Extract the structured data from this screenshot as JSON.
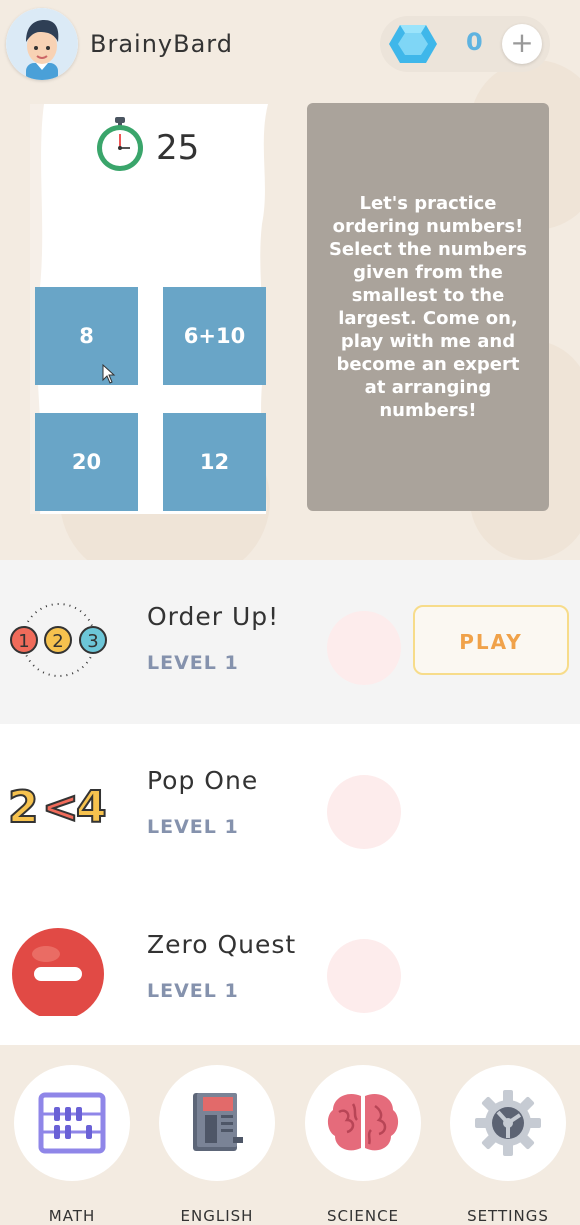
{
  "header": {
    "username": "BrainyBard",
    "gems": "0",
    "plus": "+"
  },
  "preview": {
    "timer": "25",
    "tiles": [
      "8",
      "6+10",
      "20",
      "12"
    ],
    "description": "Let's practice ordering numbers! Select the numbers given from the smallest to the largest. Come on, play with me and become an expert at arranging numbers!"
  },
  "games": [
    {
      "title": "Order Up!",
      "level": "LEVEL 1",
      "icon": "ordered-balls-icon",
      "selected": true
    },
    {
      "title": "Pop One",
      "level": "LEVEL 1",
      "icon": "two-less-than-four-icon",
      "selected": false
    },
    {
      "title": "Zero Quest",
      "level": "LEVEL 1",
      "icon": "red-minus-ball-icon",
      "selected": false
    }
  ],
  "play_label": "PLAY",
  "nav": [
    {
      "label": "MATH",
      "icon": "abacus-icon"
    },
    {
      "label": "ENGLISH",
      "icon": "book-icon"
    },
    {
      "label": "SCIENCE",
      "icon": "brain-icon"
    },
    {
      "label": "SETTINGS",
      "icon": "gear-icon"
    }
  ],
  "colors": {
    "background": "#f3ebe1",
    "tile": "#69a5c7",
    "description_card": "#aaa39b",
    "gem": "#5fb3e0",
    "play_text": "#f0a24a",
    "level_text": "#8592ad"
  }
}
